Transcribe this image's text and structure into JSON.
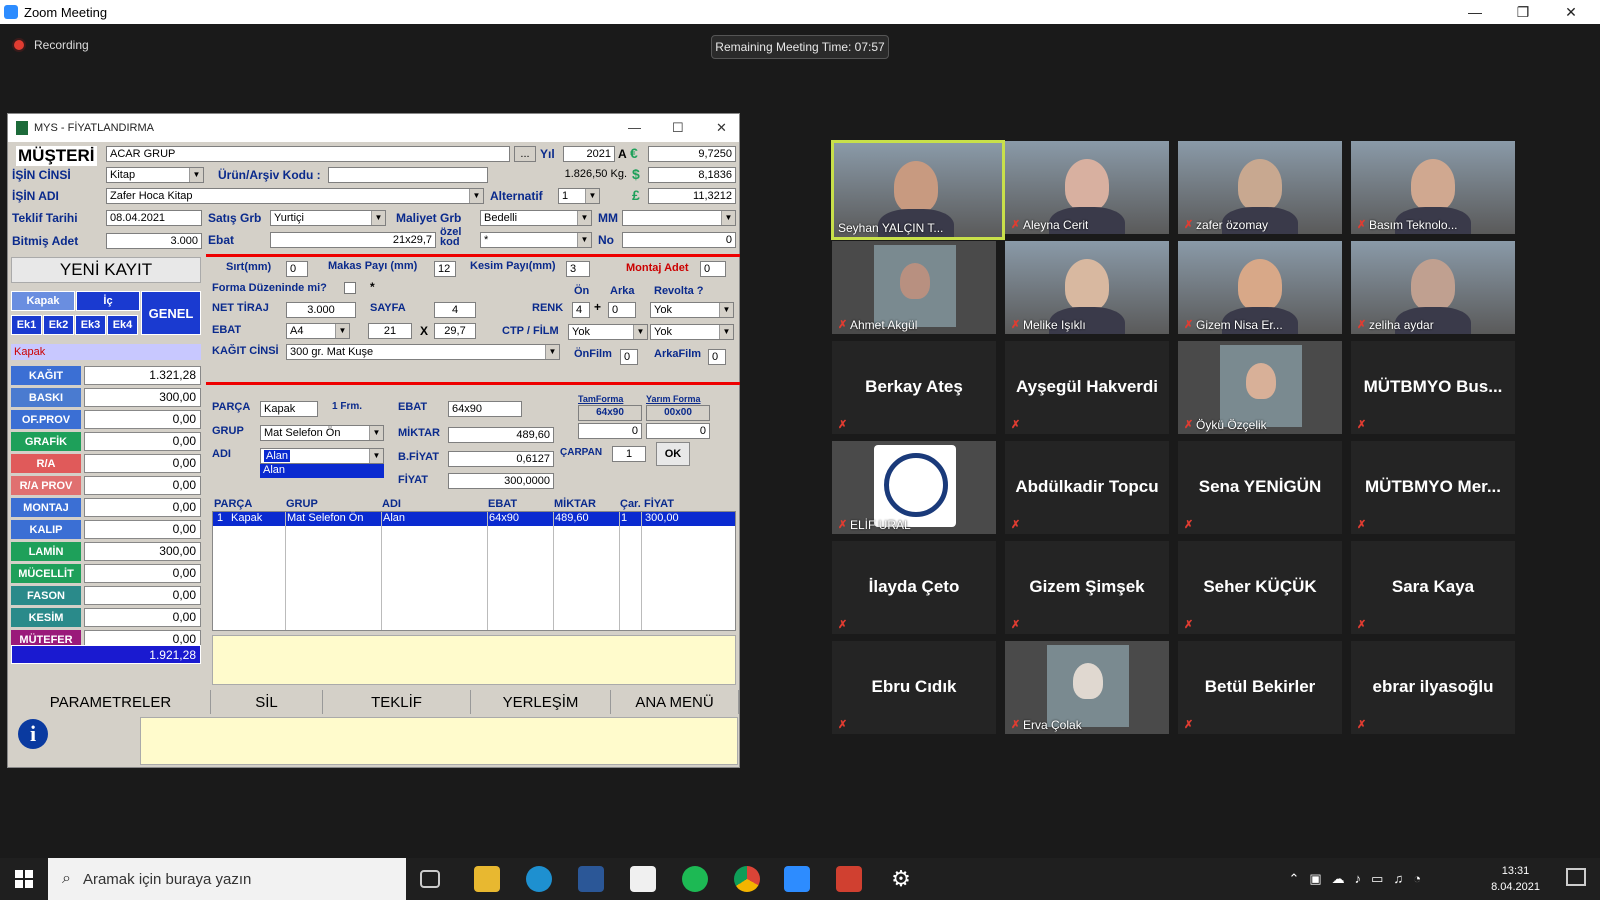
{
  "zoom": {
    "title": "Zoom Meeting",
    "recording": "Recording",
    "remaining": "Remaining Meeting Time: 07:57"
  },
  "app": {
    "title": "MYS - FİYATLANDIRMA",
    "musteri_label": "MÜŞTERİ",
    "musteri_value": "ACAR GRUP",
    "ellipsis": "...",
    "yil_label": "Yıl",
    "yil_value": "2021",
    "a_label": "A",
    "euro_sym": "€",
    "euro_value": "9,7250",
    "usd_sym": "$",
    "usd_value": "8,1836",
    "gbp_sym": "£",
    "gbp_value": "11,3212",
    "isin_cinsi_label": "İŞİN CİNSİ",
    "isin_cinsi_value": "Kitap",
    "urun_label": "Ürün/Arşiv Kodu :",
    "weight": "1.826,50 Kg.",
    "isin_adi_label": "İŞİN ADI",
    "isin_adi_value": "Zafer Hoca Kitap",
    "alternatif_label": "Alternatif",
    "alternatif_value": "1",
    "teklif_tarihi_label": "Teklif Tarihi",
    "teklif_tarihi_value": "08.04.2021",
    "satis_grb_label": "Satış Grb",
    "satis_grb_value": "Yurtiçi",
    "maliyet_grb_label": "Maliyet Grb",
    "maliyet_grb_value": "Bedelli",
    "mm_label": "MM",
    "bitmis_adet_label": "Bitmiş Adet",
    "bitmis_adet_value": "3.000",
    "ebat_label": "Ebat",
    "ebat_value": "21x29,7",
    "ozel_kod_label": "özel kod",
    "ozel_kod_value": "*",
    "no_label": "No",
    "no_value": "0",
    "yeni_kayit": "YENİ KAYIT",
    "tab_kapak": "Kapak",
    "tab_ic": "İç",
    "tab_genel": "GENEL",
    "tab_ek1": "Ek1",
    "tab_ek2": "Ek2",
    "tab_ek3": "Ek3",
    "tab_ek4": "Ek4",
    "section_label": "Kapak",
    "costs": [
      {
        "label": "KAĞIT",
        "value": "1.321,28",
        "color": "#3b6fd4"
      },
      {
        "label": "BASKI",
        "value": "300,00",
        "color": "#4a7bd0"
      },
      {
        "label": "OF.PROV",
        "value": "0,00",
        "color": "#3b6fd4"
      },
      {
        "label": "GRAFİK",
        "value": "0,00",
        "color": "#1ea05a"
      },
      {
        "label": "R/A",
        "value": "0,00",
        "color": "#e05a5a"
      },
      {
        "label": "R/A PROV",
        "value": "0,00",
        "color": "#e07070"
      },
      {
        "label": "MONTAJ",
        "value": "0,00",
        "color": "#3b6fd4"
      },
      {
        "label": "KALIP",
        "value": "0,00",
        "color": "#3b6fd4"
      },
      {
        "label": "LAMİN",
        "value": "300,00",
        "color": "#1ea05a"
      },
      {
        "label": "MÜCELLİT",
        "value": "0,00",
        "color": "#1ea05a"
      },
      {
        "label": "FASON",
        "value": "0,00",
        "color": "#2a8a8a"
      },
      {
        "label": "KESİM",
        "value": "0,00",
        "color": "#2a8a8a"
      },
      {
        "label": "MÜTEFER",
        "value": "0,00",
        "color": "#9a1a7a"
      }
    ],
    "total": "1.921,28",
    "sirt_label": "Sırt(mm)",
    "sirt_value": "0",
    "makas_label": "Makas Payı (mm)",
    "makas_value": "12",
    "kesim_label": "Kesim Payı(mm)",
    "kesim_value": "3",
    "montaj_adet_label": "Montaj Adet",
    "montaj_adet_value": "0",
    "forma_label": "Forma Düzeninde mi?",
    "forma_star": "*",
    "on_label": "Ön",
    "arka_label": "Arka",
    "revolta_label": "Revolta ?",
    "net_tiraj_label": "NET TİRAJ",
    "net_tiraj_value": "3.000",
    "sayfa_label": "SAYFA",
    "sayfa_value": "4",
    "renk_label": "RENK",
    "renk_on": "4",
    "renk_plus": "+",
    "renk_arka": "0",
    "revolta_value": "Yok",
    "ebat2_label": "EBAT",
    "ebat2_value": "A4",
    "ebat2_w": "21",
    "ebat2_x": "X",
    "ebat2_h": "29,7",
    "ctp_label": "CTP / FİLM",
    "ctp_value1": "Yok",
    "ctp_value2": "Yok",
    "kagit_cinsi_label": "KAĞIT CİNSİ",
    "kagit_cinsi_value": "300 gr. Mat Kuşe",
    "onfilm_label": "ÖnFilm",
    "onfilm_value": "0",
    "arkafilm_label": "ArkaFilm",
    "arkafilm_value": "0",
    "parca_label": "PARÇA",
    "parca_value": "Kapak",
    "frm": "1 Frm.",
    "ebat3_label": "EBAT",
    "ebat3_value": "64x90",
    "tamforma_label": "TamForma",
    "tamforma_value": "64x90",
    "yarimforma_label": "Yarım Forma",
    "yarimforma_value": "00x00",
    "tam_count": "0",
    "yarim_count": "0",
    "grup_label": "GRUP",
    "grup_value": "Mat Selefon Ön",
    "miktar_label": "MİKTAR",
    "miktar_value": "489,60",
    "adi_label": "ADI",
    "adi_value": "Alan",
    "adi_option": "Alan",
    "bfiyat_label": "B.FİYAT",
    "bfiyat_value": "0,6127",
    "carpan_label": "ÇARPAN",
    "carpan_value": "1",
    "ok_label": "OK",
    "fiyat_label": "FİYAT",
    "fiyat_value": "300,0000",
    "table_headers": [
      "PARÇA",
      "GRUP",
      "ADI",
      "EBAT",
      "MİKTAR",
      "Çar.",
      "FİYAT"
    ],
    "table_row": {
      "num": "1",
      "parca": "Kapak",
      "grup": "Mat Selefon Ön",
      "adi": "Alan",
      "ebat": "64x90",
      "miktar": "489,60",
      "car": "1",
      "fiyat": "300,00"
    },
    "btn_parametreler": "PARAMETRELER",
    "btn_sil": "SİL",
    "btn_teklif": "TEKLİF",
    "btn_yerlesim": "YERLEŞİM",
    "btn_anamenu": "ANA MENÜ"
  },
  "participants": [
    {
      "name": "Seyhan YALÇIN T...",
      "video": true
    },
    {
      "name": "Aleyna Cerit",
      "video": true
    },
    {
      "name": "zafer özomay",
      "video": true
    },
    {
      "name": "Basım Teknolo...",
      "video": true
    },
    {
      "name": "Ahmet Akgül",
      "video": true
    },
    {
      "name": "Melike Işıklı",
      "video": true
    },
    {
      "name": "Gizem Nisa Er...",
      "video": true
    },
    {
      "name": "zeliha aydar",
      "video": true
    },
    {
      "name": "Berkay Ateş",
      "video": false
    },
    {
      "name": "Ayşegül Hakverdi",
      "video": false
    },
    {
      "name": "Öykü Özçelik",
      "video": true
    },
    {
      "name": "MÜTBMYO Bus...",
      "video": false
    },
    {
      "name": "ELİF URAL",
      "video": true
    },
    {
      "name": "Abdülkadir Topcu",
      "video": false
    },
    {
      "name": "Sena YENİGÜN",
      "video": false
    },
    {
      "name": "MÜTBMYO Mer...",
      "video": false
    },
    {
      "name": "İlayda Çeto",
      "video": false
    },
    {
      "name": "Gizem Şimşek",
      "video": false
    },
    {
      "name": "Seher KÜÇÜK",
      "video": false
    },
    {
      "name": "Sara Kaya",
      "video": false
    },
    {
      "name": "Ebru Cıdık",
      "video": false
    },
    {
      "name": "Erva Çolak",
      "video": true
    },
    {
      "name": "Betül Bekirler",
      "video": false
    },
    {
      "name": "ebrar ilyasoğlu",
      "video": false
    }
  ],
  "taskbar": {
    "search_placeholder": "Aramak için buraya yazın",
    "time": "13:31",
    "date": "8.04.2021"
  }
}
